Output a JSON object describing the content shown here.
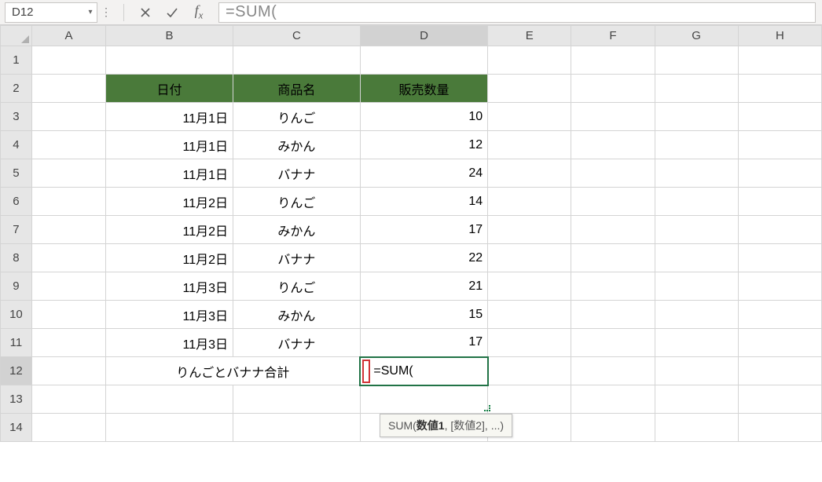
{
  "formula_bar": {
    "name_box": "D12",
    "formula_text": "=SUM("
  },
  "columns": [
    "A",
    "B",
    "C",
    "D",
    "E",
    "F",
    "G",
    "H"
  ],
  "rows": [
    1,
    2,
    3,
    4,
    5,
    6,
    7,
    8,
    9,
    10,
    11,
    12,
    13,
    14
  ],
  "active_cell": {
    "row": 12,
    "col": "D"
  },
  "table": {
    "headers": {
      "date": "日付",
      "product": "商品名",
      "qty": "販売数量"
    },
    "rows": [
      {
        "date": "11月1日",
        "product": "りんご",
        "qty": 10
      },
      {
        "date": "11月1日",
        "product": "みかん",
        "qty": 12
      },
      {
        "date": "11月1日",
        "product": "バナナ",
        "qty": 24
      },
      {
        "date": "11月2日",
        "product": "りんご",
        "qty": 14
      },
      {
        "date": "11月2日",
        "product": "みかん",
        "qty": 17
      },
      {
        "date": "11月2日",
        "product": "バナナ",
        "qty": 22
      },
      {
        "date": "11月3日",
        "product": "りんご",
        "qty": 21
      },
      {
        "date": "11月3日",
        "product": "みかん",
        "qty": 15
      },
      {
        "date": "11月3日",
        "product": "バナナ",
        "qty": 17
      }
    ],
    "total_label": "りんごとバナナ合計",
    "editing_value": "=SUM("
  },
  "tooltip": {
    "func": "SUM(",
    "arg1": "数値1",
    "rest": ", [数値2], ...)"
  },
  "colors": {
    "header_bg": "#4a7a3a",
    "accent": "#217346",
    "red": "#d13438"
  }
}
